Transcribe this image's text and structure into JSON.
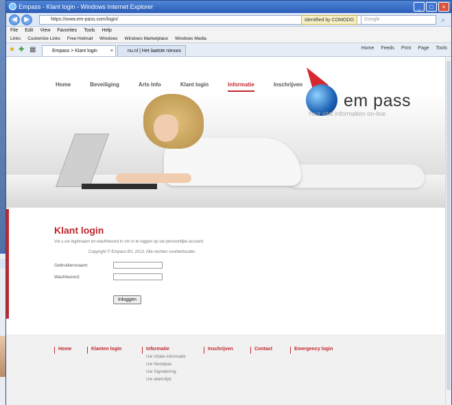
{
  "window": {
    "title": "Empass - Klant login - Windows Internet Explorer",
    "url": "https://www.em-pass.com/login/",
    "identity": "Identified by COMODO",
    "search_placeholder": "Google"
  },
  "menubar": [
    "File",
    "Edit",
    "View",
    "Favorites",
    "Tools",
    "Help"
  ],
  "linksbar": [
    "Links",
    "Customize Links",
    "Free Hotmail",
    "Windows",
    "Windows Marketplace",
    "Windows Media"
  ],
  "tabs": [
    {
      "label": "Empass > Klant login",
      "active": true
    },
    {
      "label": "nu.nl | Het laatste nieuws ho...",
      "active": false
    }
  ],
  "command_bar": [
    "Home",
    "Feeds",
    "Print",
    "Page",
    "Tools"
  ],
  "site": {
    "nav": [
      {
        "label": "Home",
        "active": false
      },
      {
        "label": "Beveiliging",
        "active": false
      },
      {
        "label": "Arts Info",
        "active": false
      },
      {
        "label": "Klant login",
        "active": false
      },
      {
        "label": "Informatie",
        "active": true
      },
      {
        "label": "Inschrijven",
        "active": false
      }
    ],
    "brand": {
      "name": "em pass",
      "tagline": "Your vital information on-line"
    },
    "login": {
      "title": "Klant login",
      "intro": "Vul u uw loginnaam en wachtwoord in om in te loggen op uw persoonlijke account.",
      "copyright": "Copyright © Empass BV, 2013. Alle rechten voorbehouden",
      "username_label": "Gebruikersnaam:",
      "password_label": "Wachtwoord:",
      "button": "Inloggen"
    },
    "footer": {
      "columns": [
        {
          "head": "Home",
          "items": []
        },
        {
          "head": "Klanten login",
          "items": []
        },
        {
          "head": "Informatie",
          "items": [
            "Uw Vitale informatie",
            "Uw Noodpas",
            "Uw Signalering",
            "Uw alarmlijst"
          ]
        },
        {
          "head": "Inschrijven",
          "items": []
        },
        {
          "head": "Contact",
          "items": []
        },
        {
          "head": "Emergency login",
          "items": []
        }
      ]
    }
  },
  "colors": {
    "accent": "#c0262d",
    "ie_title": "#2b5cb8"
  }
}
